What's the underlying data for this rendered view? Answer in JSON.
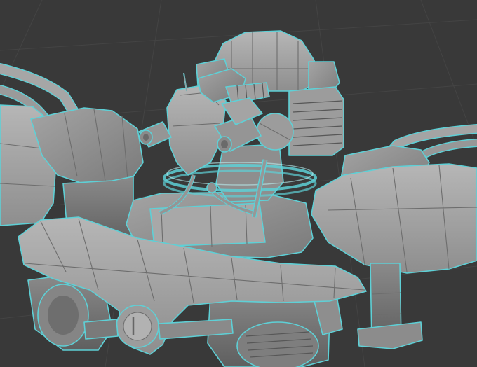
{
  "viewport": {
    "background_color": "#393939",
    "grid_color": "#444444",
    "mesh_color": "#9a9a9a",
    "mesh_shadow_color": "#7c7c7c",
    "mesh_highlight_color": "#b4b4b4",
    "selection_outline_color": "#5ed0d6"
  },
  "scene": {
    "object_icon": "robot-mech-mesh-icon",
    "shading": "solid"
  }
}
